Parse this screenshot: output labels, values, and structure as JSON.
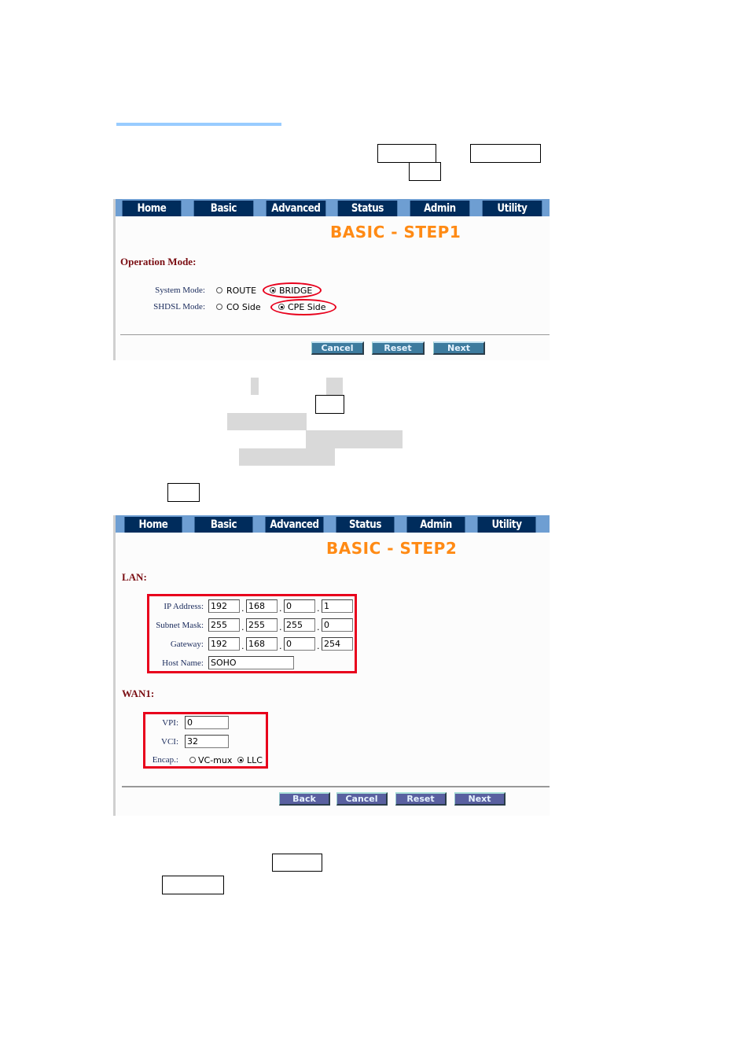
{
  "colors": {
    "nav_bg": "#002c5c",
    "nav_strip": "#6e9ed2",
    "title_orange": "#ff8a14",
    "section_maroon": "#7a0d12",
    "highlight_red": "#e8001c",
    "heading_rule": "#99ccff"
  },
  "step1": {
    "nav_tabs": [
      "Home",
      "Basic",
      "Advanced",
      "Status",
      "Admin",
      "Utility"
    ],
    "title": "BASIC - STEP1",
    "section": "Operation Mode:",
    "system_mode": {
      "label": "System Mode:",
      "options": [
        {
          "label": "ROUTE",
          "checked": false
        },
        {
          "label": "BRIDGE",
          "checked": true
        }
      ]
    },
    "shdsl_mode": {
      "label": "SHDSL Mode:",
      "options": [
        {
          "label": "CO Side",
          "checked": false
        },
        {
          "label": "CPE Side",
          "checked": true
        }
      ]
    },
    "buttons": [
      "Cancel",
      "Reset",
      "Next"
    ]
  },
  "step2": {
    "nav_tabs": [
      "Home",
      "Basic",
      "Advanced",
      "Status",
      "Admin",
      "Utility"
    ],
    "title": "BASIC - STEP2",
    "lan": {
      "section": "LAN:",
      "ip_address": {
        "label": "IP Address:",
        "octets": [
          "192",
          "168",
          "0",
          "1"
        ]
      },
      "subnet_mask": {
        "label": "Subnet Mask:",
        "octets": [
          "255",
          "255",
          "255",
          "0"
        ]
      },
      "gateway": {
        "label": "Gateway:",
        "octets": [
          "192",
          "168",
          "0",
          "254"
        ]
      },
      "host_name": {
        "label": "Host Name:",
        "value": "SOHO"
      }
    },
    "wan": {
      "section": "WAN1:",
      "vpi": {
        "label": "VPI:",
        "value": "0"
      },
      "vci": {
        "label": "VCI:",
        "value": "32"
      },
      "encap": {
        "label": "Encap.:",
        "options": [
          {
            "label": "VC-mux",
            "checked": false
          },
          {
            "label": "LLC",
            "checked": true
          }
        ]
      }
    },
    "buttons": [
      "Back",
      "Cancel",
      "Reset",
      "Next"
    ],
    "dot": "."
  }
}
